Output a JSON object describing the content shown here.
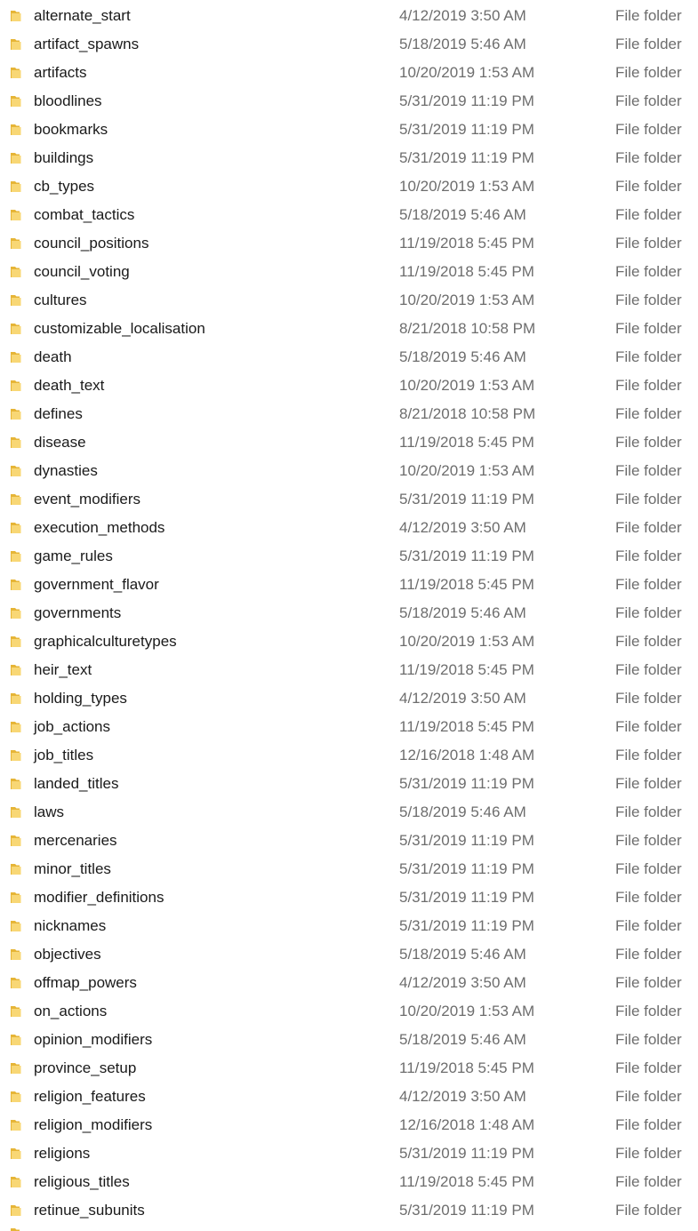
{
  "icon": "folder-icon",
  "colors": {
    "folder_body": "#f8d775",
    "folder_tab": "#e6b537",
    "name_text": "#1a1a1a",
    "meta_text": "#6d6d6d"
  },
  "files": [
    {
      "name": "alternate_start",
      "date": "4/12/2019 3:50 AM",
      "type": "File folder"
    },
    {
      "name": "artifact_spawns",
      "date": "5/18/2019 5:46 AM",
      "type": "File folder"
    },
    {
      "name": "artifacts",
      "date": "10/20/2019 1:53 AM",
      "type": "File folder"
    },
    {
      "name": "bloodlines",
      "date": "5/31/2019 11:19 PM",
      "type": "File folder"
    },
    {
      "name": "bookmarks",
      "date": "5/31/2019 11:19 PM",
      "type": "File folder"
    },
    {
      "name": "buildings",
      "date": "5/31/2019 11:19 PM",
      "type": "File folder"
    },
    {
      "name": "cb_types",
      "date": "10/20/2019 1:53 AM",
      "type": "File folder"
    },
    {
      "name": "combat_tactics",
      "date": "5/18/2019 5:46 AM",
      "type": "File folder"
    },
    {
      "name": "council_positions",
      "date": "11/19/2018 5:45 PM",
      "type": "File folder"
    },
    {
      "name": "council_voting",
      "date": "11/19/2018 5:45 PM",
      "type": "File folder"
    },
    {
      "name": "cultures",
      "date": "10/20/2019 1:53 AM",
      "type": "File folder"
    },
    {
      "name": "customizable_localisation",
      "date": "8/21/2018 10:58 PM",
      "type": "File folder"
    },
    {
      "name": "death",
      "date": "5/18/2019 5:46 AM",
      "type": "File folder"
    },
    {
      "name": "death_text",
      "date": "10/20/2019 1:53 AM",
      "type": "File folder"
    },
    {
      "name": "defines",
      "date": "8/21/2018 10:58 PM",
      "type": "File folder"
    },
    {
      "name": "disease",
      "date": "11/19/2018 5:45 PM",
      "type": "File folder"
    },
    {
      "name": "dynasties",
      "date": "10/20/2019 1:53 AM",
      "type": "File folder"
    },
    {
      "name": "event_modifiers",
      "date": "5/31/2019 11:19 PM",
      "type": "File folder"
    },
    {
      "name": "execution_methods",
      "date": "4/12/2019 3:50 AM",
      "type": "File folder"
    },
    {
      "name": "game_rules",
      "date": "5/31/2019 11:19 PM",
      "type": "File folder"
    },
    {
      "name": "government_flavor",
      "date": "11/19/2018 5:45 PM",
      "type": "File folder"
    },
    {
      "name": "governments",
      "date": "5/18/2019 5:46 AM",
      "type": "File folder"
    },
    {
      "name": "graphicalculturetypes",
      "date": "10/20/2019 1:53 AM",
      "type": "File folder"
    },
    {
      "name": "heir_text",
      "date": "11/19/2018 5:45 PM",
      "type": "File folder"
    },
    {
      "name": "holding_types",
      "date": "4/12/2019 3:50 AM",
      "type": "File folder"
    },
    {
      "name": "job_actions",
      "date": "11/19/2018 5:45 PM",
      "type": "File folder"
    },
    {
      "name": "job_titles",
      "date": "12/16/2018 1:48 AM",
      "type": "File folder"
    },
    {
      "name": "landed_titles",
      "date": "5/31/2019 11:19 PM",
      "type": "File folder"
    },
    {
      "name": "laws",
      "date": "5/18/2019 5:46 AM",
      "type": "File folder"
    },
    {
      "name": "mercenaries",
      "date": "5/31/2019 11:19 PM",
      "type": "File folder"
    },
    {
      "name": "minor_titles",
      "date": "5/31/2019 11:19 PM",
      "type": "File folder"
    },
    {
      "name": "modifier_definitions",
      "date": "5/31/2019 11:19 PM",
      "type": "File folder"
    },
    {
      "name": "nicknames",
      "date": "5/31/2019 11:19 PM",
      "type": "File folder"
    },
    {
      "name": "objectives",
      "date": "5/18/2019 5:46 AM",
      "type": "File folder"
    },
    {
      "name": "offmap_powers",
      "date": "4/12/2019 3:50 AM",
      "type": "File folder"
    },
    {
      "name": "on_actions",
      "date": "10/20/2019 1:53 AM",
      "type": "File folder"
    },
    {
      "name": "opinion_modifiers",
      "date": "5/18/2019 5:46 AM",
      "type": "File folder"
    },
    {
      "name": "province_setup",
      "date": "11/19/2018 5:45 PM",
      "type": "File folder"
    },
    {
      "name": "religion_features",
      "date": "4/12/2019 3:50 AM",
      "type": "File folder"
    },
    {
      "name": "religion_modifiers",
      "date": "12/16/2018 1:48 AM",
      "type": "File folder"
    },
    {
      "name": "religions",
      "date": "5/31/2019 11:19 PM",
      "type": "File folder"
    },
    {
      "name": "religious_titles",
      "date": "11/19/2018 5:45 PM",
      "type": "File folder"
    },
    {
      "name": "retinue_subunits",
      "date": "5/31/2019 11:19 PM",
      "type": "File folder"
    }
  ]
}
